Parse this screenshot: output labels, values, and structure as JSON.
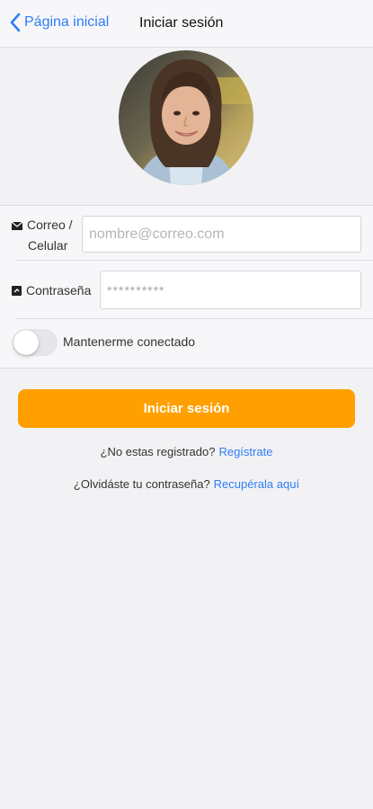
{
  "nav": {
    "back_label": "Página inicial",
    "title": "Iniciar sesión"
  },
  "form": {
    "email_label_line1": "Correo /",
    "email_label_line2": "Celular",
    "email_placeholder": "nombre@correo.com",
    "password_label": "Contraseña",
    "password_value": "**********",
    "remember_label": "Mantenerme conectado",
    "remember_on": false
  },
  "actions": {
    "login_label": "Iniciar sesión",
    "register_prompt": "¿No estas registrado?",
    "register_link": "Regístrate",
    "forgot_prompt": "¿Olvidáste tu contraseña?",
    "forgot_link": "Recupérala aquí"
  },
  "colors": {
    "accent": "#2f7df6",
    "primary_button": "#ffa000",
    "background": "#f2f2f5"
  },
  "icons": {
    "back": "chevron-left-icon",
    "email": "envelope-icon",
    "password": "lock-icon"
  }
}
